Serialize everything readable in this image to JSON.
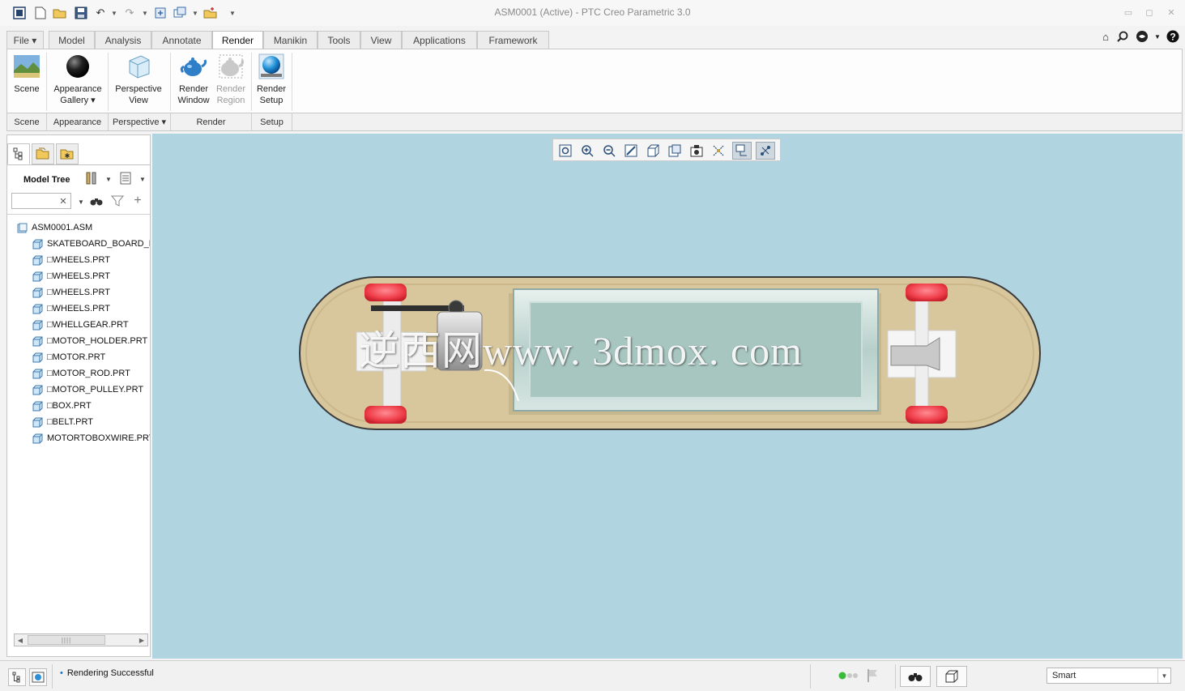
{
  "window": {
    "title": "ASM0001 (Active) - PTC Creo Parametric 3.0"
  },
  "quick_access": [
    "new-icon",
    "open-icon",
    "save-icon",
    "undo-icon",
    "redo-icon",
    "regenerate-icon",
    "windows-icon",
    "close-window-icon",
    "customize-icon"
  ],
  "tabs": [
    {
      "label": "File ▾"
    },
    {
      "label": "Model"
    },
    {
      "label": "Analysis"
    },
    {
      "label": "Annotate"
    },
    {
      "label": "Render"
    },
    {
      "label": "Manikin"
    },
    {
      "label": "Tools"
    },
    {
      "label": "View"
    },
    {
      "label": "Applications"
    },
    {
      "label": "Framework"
    }
  ],
  "active_tab": "Render",
  "ribbon": {
    "buttons": [
      {
        "line1": "Scene",
        "line2": ""
      },
      {
        "line1": "Appearance",
        "line2": "Gallery ▾"
      },
      {
        "line1": "Perspective",
        "line2": "View"
      },
      {
        "line1": "Render",
        "line2": "Window"
      },
      {
        "line1": "Render",
        "line2": "Region"
      },
      {
        "line1": "Render",
        "line2": "Setup"
      }
    ],
    "groups": [
      {
        "label": "Scene"
      },
      {
        "label": "Appearance"
      },
      {
        "label": "Perspective ▾"
      },
      {
        "label": "Render"
      },
      {
        "label": "Setup"
      }
    ]
  },
  "model_tree": {
    "title": "Model Tree",
    "search_value": "",
    "items": [
      {
        "label": "ASM0001.ASM"
      },
      {
        "label": "SKATEBOARD_BOARD_R"
      },
      {
        "label": "□WHEELS.PRT"
      },
      {
        "label": "□WHEELS.PRT"
      },
      {
        "label": "□WHEELS.PRT"
      },
      {
        "label": "□WHEELS.PRT"
      },
      {
        "label": "□WHELLGEAR.PRT"
      },
      {
        "label": "□MOTOR_HOLDER.PRT"
      },
      {
        "label": "□MOTOR.PRT"
      },
      {
        "label": "□MOTOR_ROD.PRT"
      },
      {
        "label": "□MOTOR_PULLEY.PRT"
      },
      {
        "label": "□BOX.PRT"
      },
      {
        "label": "□BELT.PRT"
      },
      {
        "label": "MOTORTOBOXWIRE.PRT"
      }
    ]
  },
  "viewport": {
    "background": "#b1d4e1",
    "watermark": "逆西网www. 3dmox. com"
  },
  "status": {
    "message": "Rendering Successful",
    "filter_value": "Smart"
  },
  "colors": {
    "accent": "#1b6cc4",
    "board": "#d8c79d",
    "wheel": "#f04b55"
  }
}
